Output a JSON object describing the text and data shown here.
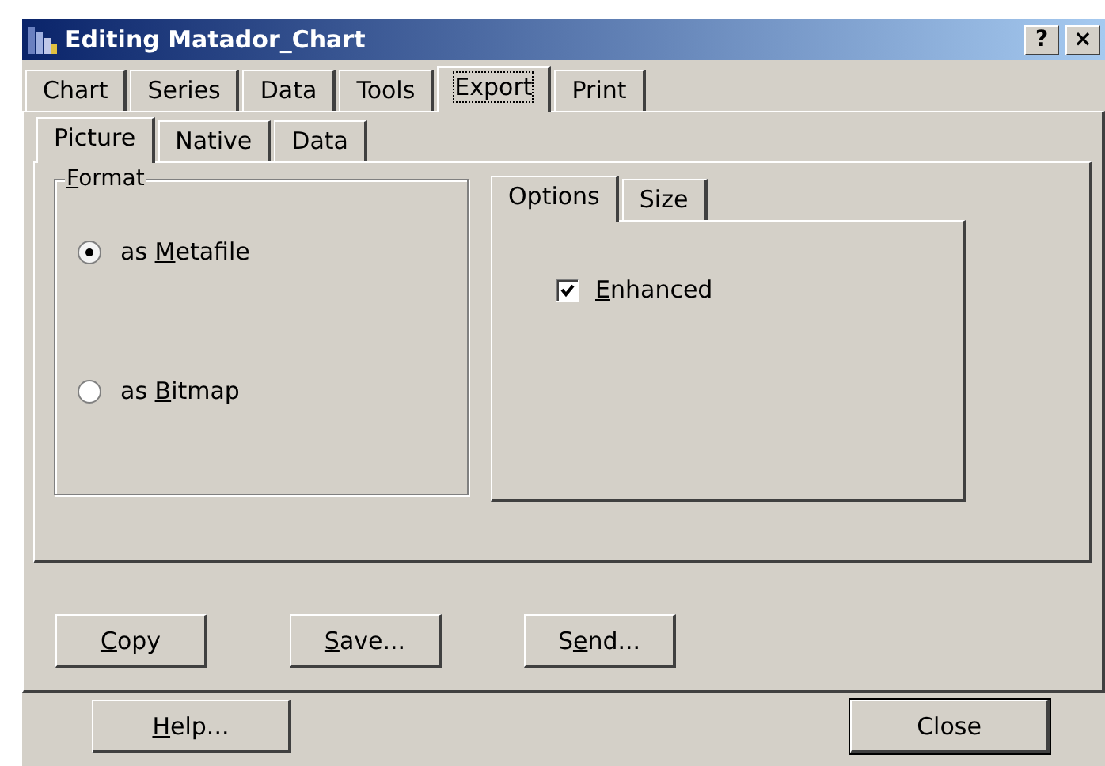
{
  "window": {
    "title": "Editing Matador_Chart",
    "title_buttons": [
      "?",
      "×"
    ]
  },
  "tabs": [
    {
      "label": "Chart",
      "selected": false
    },
    {
      "label": "Series",
      "selected": false
    },
    {
      "label": "Data",
      "selected": false
    },
    {
      "label": "Tools",
      "selected": false
    },
    {
      "label": "Export",
      "selected": true
    },
    {
      "label": "Print",
      "selected": false
    }
  ],
  "sub_tabs": [
    {
      "label": "Picture",
      "selected": true
    },
    {
      "label": "Native",
      "selected": false
    },
    {
      "label": "Data",
      "selected": false
    }
  ],
  "format_group": {
    "title": {
      "key": "F",
      "after": "ormat"
    },
    "options": [
      {
        "label": {
          "before": "as ",
          "key": "M",
          "after": "etafile"
        },
        "selected": true
      },
      {
        "label": {
          "before": "as ",
          "key": "B",
          "after": "itmap"
        },
        "selected": false
      }
    ]
  },
  "options_tabs": [
    {
      "label": "Options",
      "selected": true
    },
    {
      "label": "Size",
      "selected": false
    }
  ],
  "enhanced": {
    "label": {
      "key": "E",
      "after": "nhanced"
    },
    "checked": true
  },
  "action_buttons": [
    {
      "label": {
        "key": "C",
        "after": "opy"
      }
    },
    {
      "label": {
        "key": "S",
        "after": "ave..."
      }
    },
    {
      "label": {
        "before": "S",
        "key": "e",
        "after": "nd..."
      }
    }
  ],
  "footer_buttons": [
    {
      "label": {
        "key": "H",
        "after": "elp..."
      },
      "default": false
    },
    {
      "label": {
        "before": "Close"
      },
      "default": true
    }
  ]
}
